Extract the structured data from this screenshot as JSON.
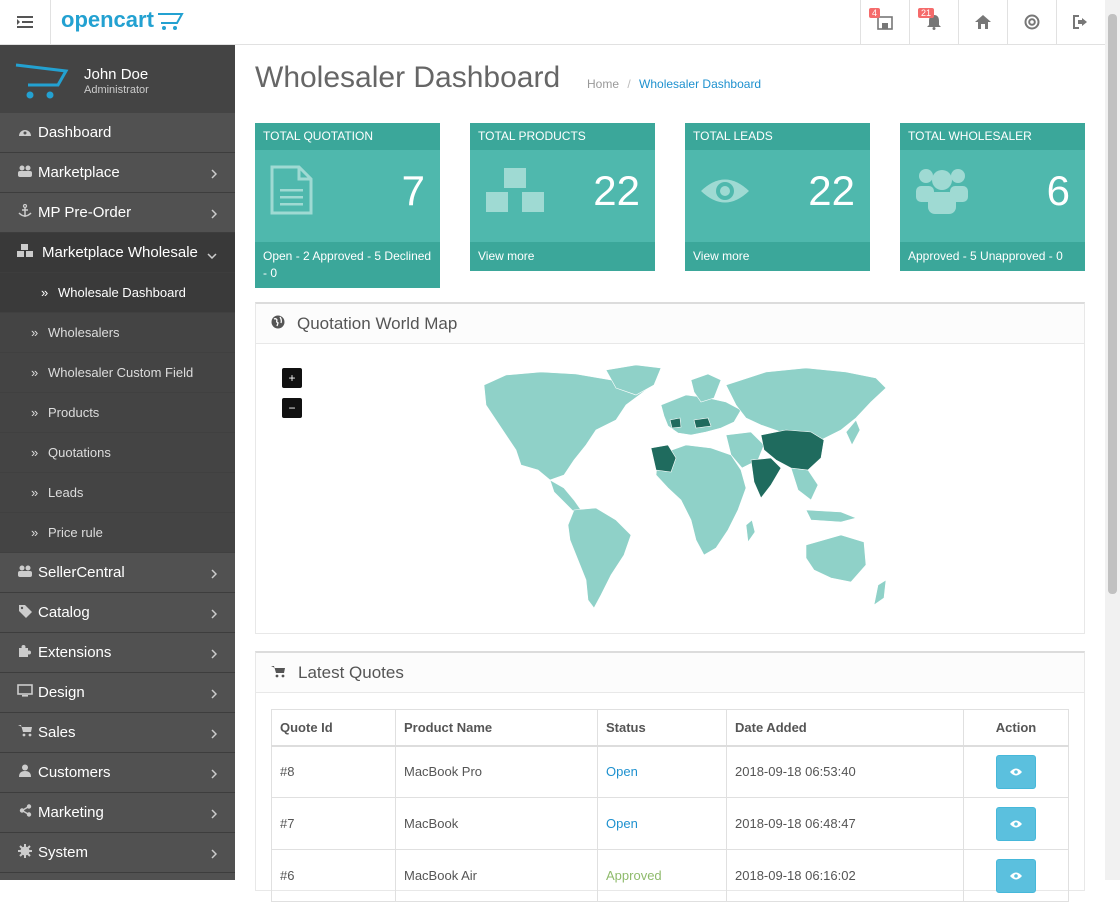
{
  "header": {
    "logo_text": "opencart",
    "icons": [
      {
        "name": "store-icon",
        "badge": "4"
      },
      {
        "name": "bell-icon",
        "badge": "21"
      },
      {
        "name": "home-icon",
        "badge": ""
      },
      {
        "name": "support-icon",
        "badge": ""
      },
      {
        "name": "logout-icon",
        "badge": ""
      }
    ]
  },
  "profile": {
    "name": "John Doe",
    "role": "Administrator"
  },
  "sidebar": {
    "items": [
      {
        "label": "Dashboard",
        "icon": "dashboard-icon"
      },
      {
        "label": "Marketplace",
        "icon": "users-icon"
      },
      {
        "label": "MP Pre-Order",
        "icon": "anchor-icon"
      },
      {
        "label": "Marketplace Wholesale",
        "icon": "cubes-icon"
      },
      {
        "label": "SellerCentral",
        "icon": "users-icon"
      },
      {
        "label": "Catalog",
        "icon": "tags-icon"
      },
      {
        "label": "Extensions",
        "icon": "puzzle-icon"
      },
      {
        "label": "Design",
        "icon": "monitor-icon"
      },
      {
        "label": "Sales",
        "icon": "cart-icon"
      },
      {
        "label": "Customers",
        "icon": "user-icon"
      },
      {
        "label": "Marketing",
        "icon": "share-icon"
      },
      {
        "label": "System",
        "icon": "cog-icon"
      }
    ],
    "subitems": [
      {
        "label": "Wholesale Dashboard"
      },
      {
        "label": "Wholesalers"
      },
      {
        "label": "Wholesaler Custom Field"
      },
      {
        "label": "Products"
      },
      {
        "label": "Quotations"
      },
      {
        "label": "Leads"
      },
      {
        "label": "Price rule"
      }
    ]
  },
  "page": {
    "title": "Wholesaler Dashboard",
    "breadcrumb": {
      "home": "Home",
      "separator": "/",
      "current": "Wholesaler Dashboard"
    }
  },
  "tiles": [
    {
      "title": "TOTAL QUOTATION",
      "value": "7",
      "footer": "Open - 2 Approved - 5 Declined - 0"
    },
    {
      "title": "TOTAL PRODUCTS",
      "value": "22",
      "footer": "View more"
    },
    {
      "title": "TOTAL LEADS",
      "value": "22",
      "footer": "View more"
    },
    {
      "title": "TOTAL WHOLESALER",
      "value": "6",
      "footer": "Approved - 5 Unapproved - 0"
    }
  ],
  "map_panel": {
    "title": "Quotation World Map",
    "zoom_in": "+",
    "zoom_out": "−"
  },
  "quotes_panel": {
    "title": "Latest Quotes",
    "columns": [
      "Quote Id",
      "Product Name",
      "Status",
      "Date Added",
      "Action"
    ],
    "rows": [
      {
        "id": "#8",
        "product": "MacBook Pro",
        "status": "Open",
        "date": "2018-09-18 06:53:40"
      },
      {
        "id": "#7",
        "product": "MacBook",
        "status": "Open",
        "date": "2018-09-18 06:48:47"
      },
      {
        "id": "#6",
        "product": "MacBook Air",
        "status": "Approved",
        "date": "2018-09-18 06:16:02"
      }
    ]
  },
  "colors": {
    "accent": "#1e91cf",
    "tile": "#4fb8ad",
    "tile_dark": "#3ba79a",
    "sidebar": "#515151",
    "map_land": "#8fd1c8",
    "map_dark": "#1f6b5e"
  }
}
